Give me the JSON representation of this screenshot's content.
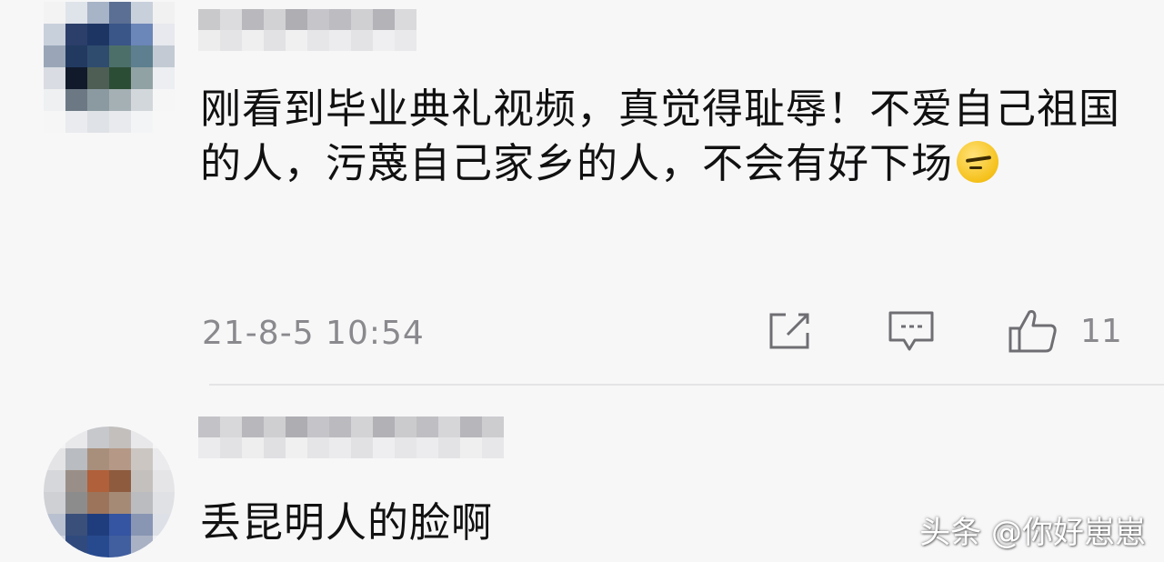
{
  "comments": [
    {
      "text": "刚看到毕业典礼视频，真觉得耻辱！不爱自己祖国的人，污蔑自己家乡的人，不会有好下场",
      "emoji": "grimace-emoji",
      "timestamp": "21-8-5 10:54",
      "likes": "11"
    },
    {
      "text": "丢昆明人的脸啊"
    }
  ],
  "watermark": "头条 @你好崽崽",
  "icons": {
    "share": "share-edit-icon",
    "reply": "comment-icon",
    "like": "thumbs-up-icon"
  }
}
